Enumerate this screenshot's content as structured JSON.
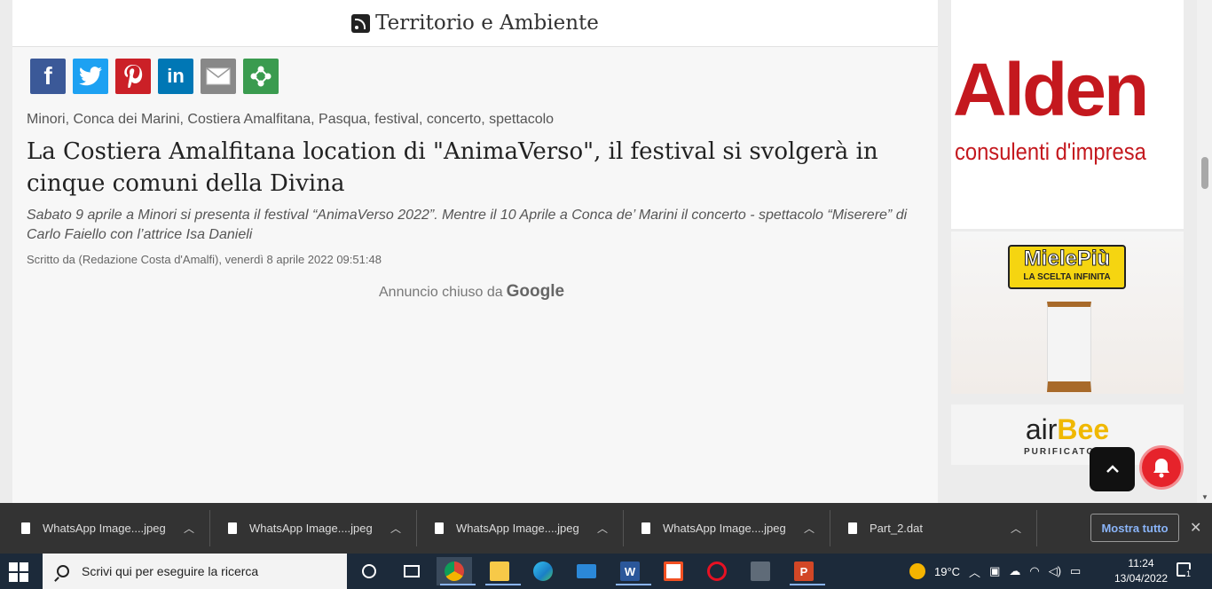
{
  "article": {
    "section_title": "Territorio e Ambiente",
    "tags": "Minori, Conca dei Marini, Costiera Amalfitana, Pasqua, festival, concerto, spettacolo",
    "headline": "La Costiera Amalfitana location di \"AnimaVerso\", il festival si svolgerà in cinque comuni della Divina",
    "summary": "Sabato 9 aprile a Minori si presenta il festival “AnimaVerso 2022”. Mentre il 10 Aprile a Conca de’ Marini il concerto - spettacolo “Miserere” di Carlo Faiello con l’attrice Isa Danieli",
    "byline": "Scritto da (Redazione Costa d'Amalfi), venerdì 8 aprile 2022 09:51:48",
    "ad_closed_text": "Annuncio chiuso da",
    "ad_closed_brand": "Google",
    "share_buttons": [
      "facebook",
      "twitter",
      "pinterest",
      "linkedin",
      "email",
      "more"
    ]
  },
  "sidebar": {
    "alden_brand": "Alden",
    "alden_sub": "consulenti d'impresa",
    "miele_brand": "MielePiù",
    "miele_tagline": "LA SCELTA INFINITA",
    "airbee_brand_a": "air",
    "airbee_brand_b": "Bee",
    "airbee_sub": "PURIFICATORE"
  },
  "downloads": {
    "items": [
      {
        "name": "WhatsApp Image....jpeg"
      },
      {
        "name": "WhatsApp Image....jpeg"
      },
      {
        "name": "WhatsApp Image....jpeg"
      },
      {
        "name": "WhatsApp Image....jpeg"
      },
      {
        "name": "Part_2.dat"
      }
    ],
    "show_all": "Mostra tutto"
  },
  "taskbar": {
    "search_placeholder": "Scrivi qui per eseguire la ricerca",
    "temperature": "19°C",
    "time": "11:24",
    "date": "13/04/2022",
    "notification_count": "1"
  },
  "colors": {
    "alden_red": "#c4181e",
    "bell_red": "#e6232b",
    "taskbar": "#1c2a3a",
    "download_bar": "#333333"
  }
}
